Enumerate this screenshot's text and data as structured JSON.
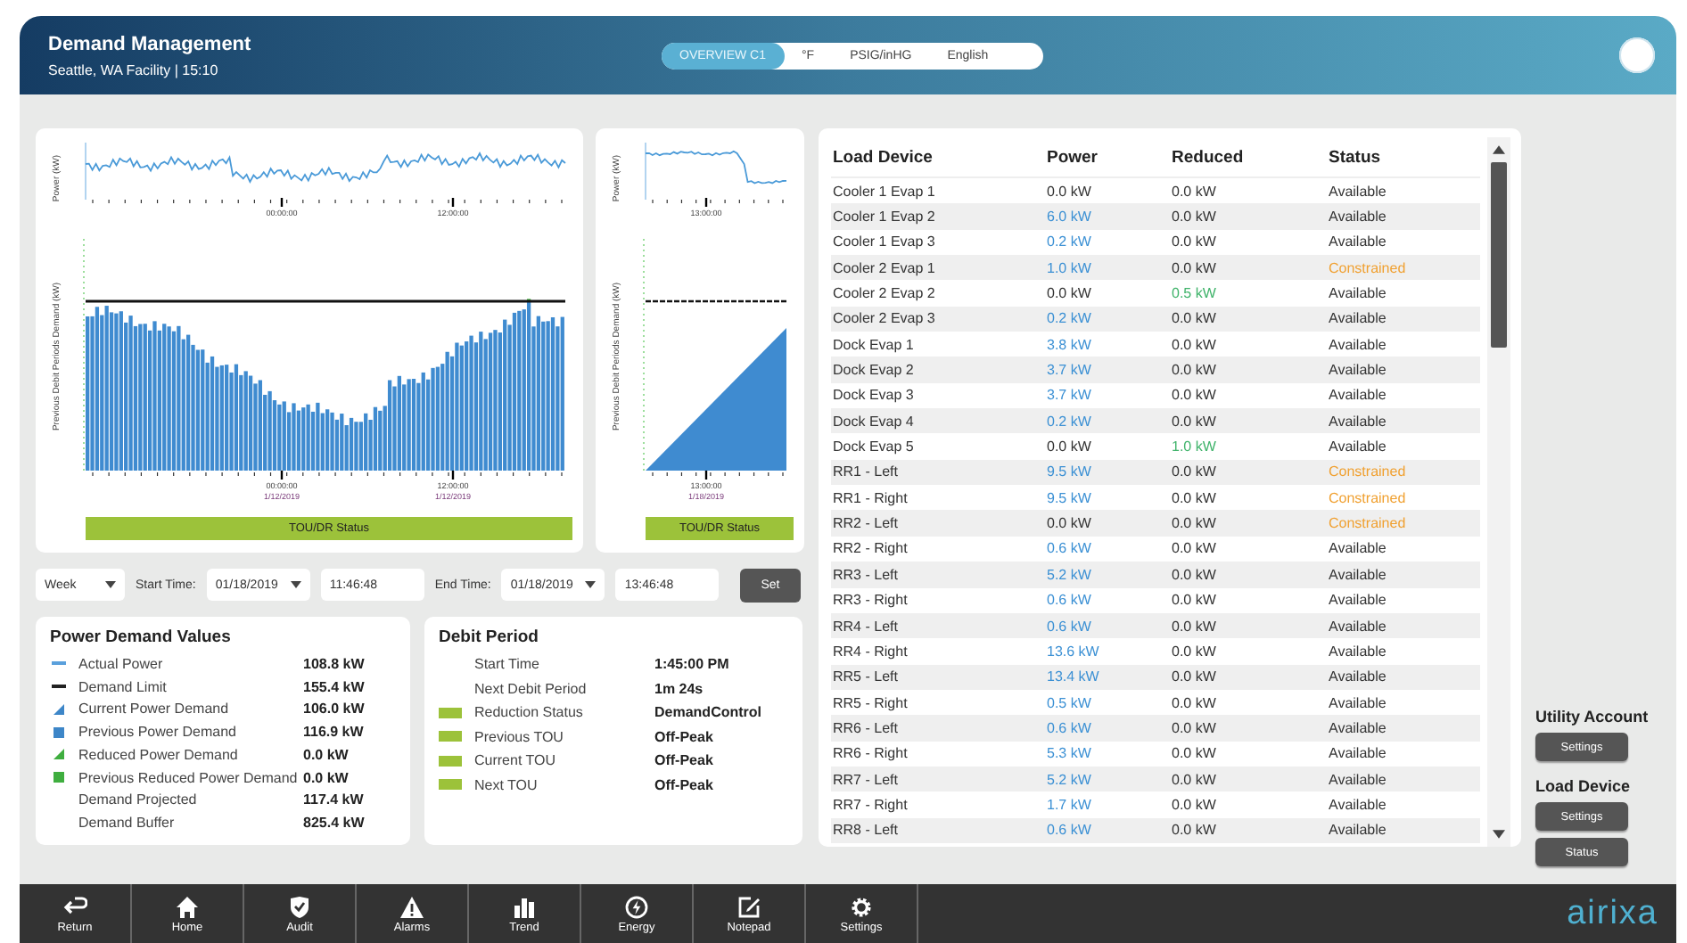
{
  "header": {
    "title": "Demand Management",
    "subtitle": "Seattle, WA Facility | 15:10"
  },
  "tabs": [
    {
      "label": "OVERVIEW C1",
      "selected": true
    },
    {
      "label": "°F",
      "selected": false
    },
    {
      "label": "PSIG/inHG",
      "selected": false
    },
    {
      "label": "English",
      "selected": false
    }
  ],
  "main_chart": {
    "top_ylabel": "Power (kW)",
    "top_xticks": [
      "00:00:00",
      "12:00:00"
    ],
    "ylabel": "Previous Debit Periods Demand (kW)",
    "xticks": [
      {
        "time": "00:00:00",
        "date": "1/12/2019"
      },
      {
        "time": "12:00:00",
        "date": "1/12/2019"
      }
    ],
    "status_bar": "TOU/DR Status"
  },
  "side_chart": {
    "top_ylabel": "Power (kW)",
    "top_xticks": [
      "13:00:00"
    ],
    "ylabel": "Previous Debit Periods Demand (kW)",
    "xticks": [
      {
        "time": "13:00:00",
        "date": "1/18/2019"
      }
    ],
    "status_bar": "TOU/DR Status"
  },
  "controls": {
    "range": "Week",
    "start_label": "Start Time:",
    "start_date": "01/18/2019",
    "start_time": "11:46:48",
    "end_label": "End Time:",
    "end_date": "01/18/2019",
    "end_time": "13:46:48",
    "button": "Set"
  },
  "power_demand": {
    "title": "Power Demand Values",
    "items": [
      {
        "label": "Actual Power",
        "value": "108.8 kW",
        "kind": "line",
        "color": "#5aa0dc"
      },
      {
        "label": "Demand Limit",
        "value": "155.4 kW",
        "kind": "line",
        "color": "#222222"
      },
      {
        "label": "Current Power Demand",
        "value": "106.0 kW",
        "kind": "triangle",
        "color": "#3d86c8"
      },
      {
        "label": "Previous Power Demand",
        "value": "116.9 kW",
        "kind": "square",
        "color": "#3d86c8"
      },
      {
        "label": "Reduced Power Demand",
        "value": "0.0 kW",
        "kind": "triangle",
        "color": "#3fae3f"
      },
      {
        "label": "Previous Reduced Power Demand",
        "value": "0.0 kW",
        "kind": "square",
        "color": "#3fae3f"
      },
      {
        "label": "Demand Projected",
        "value": "117.4 kW"
      },
      {
        "label": "Demand Buffer",
        "value": "825.4 kW"
      }
    ]
  },
  "debit_period": {
    "title": "Debit Period",
    "items": [
      {
        "label": "Start Time",
        "value": "1:45:00 PM"
      },
      {
        "label": "Next Debit Period",
        "value": "1m 24s"
      },
      {
        "label": "Reduction Status",
        "value": "DemandControl",
        "kind": "bar",
        "color": "#9cc23a"
      },
      {
        "label": "Previous TOU",
        "value": "Off-Peak",
        "kind": "bar",
        "color": "#9cc23a"
      },
      {
        "label": "Current TOU",
        "value": "Off-Peak",
        "kind": "bar",
        "color": "#9cc23a"
      },
      {
        "label": "Next TOU",
        "value": "Off-Peak",
        "kind": "bar",
        "color": "#9cc23a"
      }
    ]
  },
  "table": {
    "columns": [
      "Load Device",
      "Power",
      "Reduced",
      "Status"
    ],
    "rows": [
      {
        "device": "Cooler 1 Evap 1",
        "power": "0.0 kW",
        "power_on": false,
        "reduced": "0.0 kW",
        "reducing": false,
        "status": "Available",
        "constrained": false
      },
      {
        "device": "Cooler 1 Evap 2",
        "power": "6.0 kW",
        "power_on": true,
        "reduced": "0.0 kW",
        "reducing": false,
        "status": "Available",
        "constrained": false
      },
      {
        "device": "Cooler 1 Evap 3",
        "power": "0.2 kW",
        "power_on": true,
        "reduced": "0.0 kW",
        "reducing": false,
        "status": "Available",
        "constrained": false
      },
      {
        "device": "Cooler 2 Evap 1",
        "power": "1.0 kW",
        "power_on": true,
        "reduced": "0.0 kW",
        "reducing": false,
        "status": "Constrained",
        "constrained": true
      },
      {
        "device": "Cooler 2 Evap 2",
        "power": "0.0 kW",
        "power_on": false,
        "reduced": "0.5 kW",
        "reducing": true,
        "status": "Available",
        "constrained": false
      },
      {
        "device": "Cooler 2 Evap 3",
        "power": "0.2 kW",
        "power_on": true,
        "reduced": "0.0 kW",
        "reducing": false,
        "status": "Available",
        "constrained": false
      },
      {
        "device": "Dock Evap 1",
        "power": "3.8 kW",
        "power_on": true,
        "reduced": "0.0 kW",
        "reducing": false,
        "status": "Available",
        "constrained": false
      },
      {
        "device": "Dock Evap 2",
        "power": "3.7 kW",
        "power_on": true,
        "reduced": "0.0 kW",
        "reducing": false,
        "status": "Available",
        "constrained": false
      },
      {
        "device": "Dock Evap 3",
        "power": "3.7 kW",
        "power_on": true,
        "reduced": "0.0 kW",
        "reducing": false,
        "status": "Available",
        "constrained": false
      },
      {
        "device": "Dock Evap 4",
        "power": "0.2 kW",
        "power_on": true,
        "reduced": "0.0 kW",
        "reducing": false,
        "status": "Available",
        "constrained": false
      },
      {
        "device": "Dock Evap 5",
        "power": "0.0 kW",
        "power_on": false,
        "reduced": "1.0 kW",
        "reducing": true,
        "status": "Available",
        "constrained": false
      },
      {
        "device": "RR1 - Left",
        "power": "9.5 kW",
        "power_on": true,
        "reduced": "0.0 kW",
        "reducing": false,
        "status": "Constrained",
        "constrained": true
      },
      {
        "device": "RR1 - Right",
        "power": "9.5 kW",
        "power_on": true,
        "reduced": "0.0 kW",
        "reducing": false,
        "status": "Constrained",
        "constrained": true
      },
      {
        "device": "RR2 - Left",
        "power": "0.0 kW",
        "power_on": false,
        "reduced": "0.0 kW",
        "reducing": false,
        "status": "Constrained",
        "constrained": true
      },
      {
        "device": "RR2 - Right",
        "power": "0.6 kW",
        "power_on": true,
        "reduced": "0.0 kW",
        "reducing": false,
        "status": "Available",
        "constrained": false
      },
      {
        "device": "RR3 - Left",
        "power": "5.2 kW",
        "power_on": true,
        "reduced": "0.0 kW",
        "reducing": false,
        "status": "Available",
        "constrained": false
      },
      {
        "device": "RR3 - Right",
        "power": "0.6 kW",
        "power_on": true,
        "reduced": "0.0 kW",
        "reducing": false,
        "status": "Available",
        "constrained": false
      },
      {
        "device": "RR4 - Left",
        "power": "0.6 kW",
        "power_on": true,
        "reduced": "0.0 kW",
        "reducing": false,
        "status": "Available",
        "constrained": false
      },
      {
        "device": "RR4 - Right",
        "power": "13.6 kW",
        "power_on": true,
        "reduced": "0.0 kW",
        "reducing": false,
        "status": "Available",
        "constrained": false
      },
      {
        "device": "RR5 - Left",
        "power": "13.4 kW",
        "power_on": true,
        "reduced": "0.0 kW",
        "reducing": false,
        "status": "Available",
        "constrained": false
      },
      {
        "device": "RR5 - Right",
        "power": "0.5 kW",
        "power_on": true,
        "reduced": "0.0 kW",
        "reducing": false,
        "status": "Available",
        "constrained": false
      },
      {
        "device": "RR6 - Left",
        "power": "0.6 kW",
        "power_on": true,
        "reduced": "0.0 kW",
        "reducing": false,
        "status": "Available",
        "constrained": false
      },
      {
        "device": "RR6 - Right",
        "power": "5.3 kW",
        "power_on": true,
        "reduced": "0.0 kW",
        "reducing": false,
        "status": "Available",
        "constrained": false
      },
      {
        "device": "RR7 - Left",
        "power": "5.2 kW",
        "power_on": true,
        "reduced": "0.0 kW",
        "reducing": false,
        "status": "Available",
        "constrained": false
      },
      {
        "device": "RR7 - Right",
        "power": "1.7 kW",
        "power_on": true,
        "reduced": "0.0 kW",
        "reducing": false,
        "status": "Available",
        "constrained": false
      },
      {
        "device": "RR8 - Left",
        "power": "0.6 kW",
        "power_on": true,
        "reduced": "0.0 kW",
        "reducing": false,
        "status": "Available",
        "constrained": false
      }
    ]
  },
  "sidebar": [
    {
      "title": "Utility Account",
      "buttons": [
        "Settings"
      ]
    },
    {
      "title": "Load Device",
      "buttons": [
        "Settings",
        "Status"
      ]
    }
  ],
  "nav": [
    {
      "label": "Return"
    },
    {
      "label": "Home"
    },
    {
      "label": "Audit"
    },
    {
      "label": "Alarms"
    },
    {
      "label": "Trend"
    },
    {
      "label": "Energy"
    },
    {
      "label": "Notepad"
    },
    {
      "label": "Settings"
    }
  ],
  "logo": "airixa"
}
